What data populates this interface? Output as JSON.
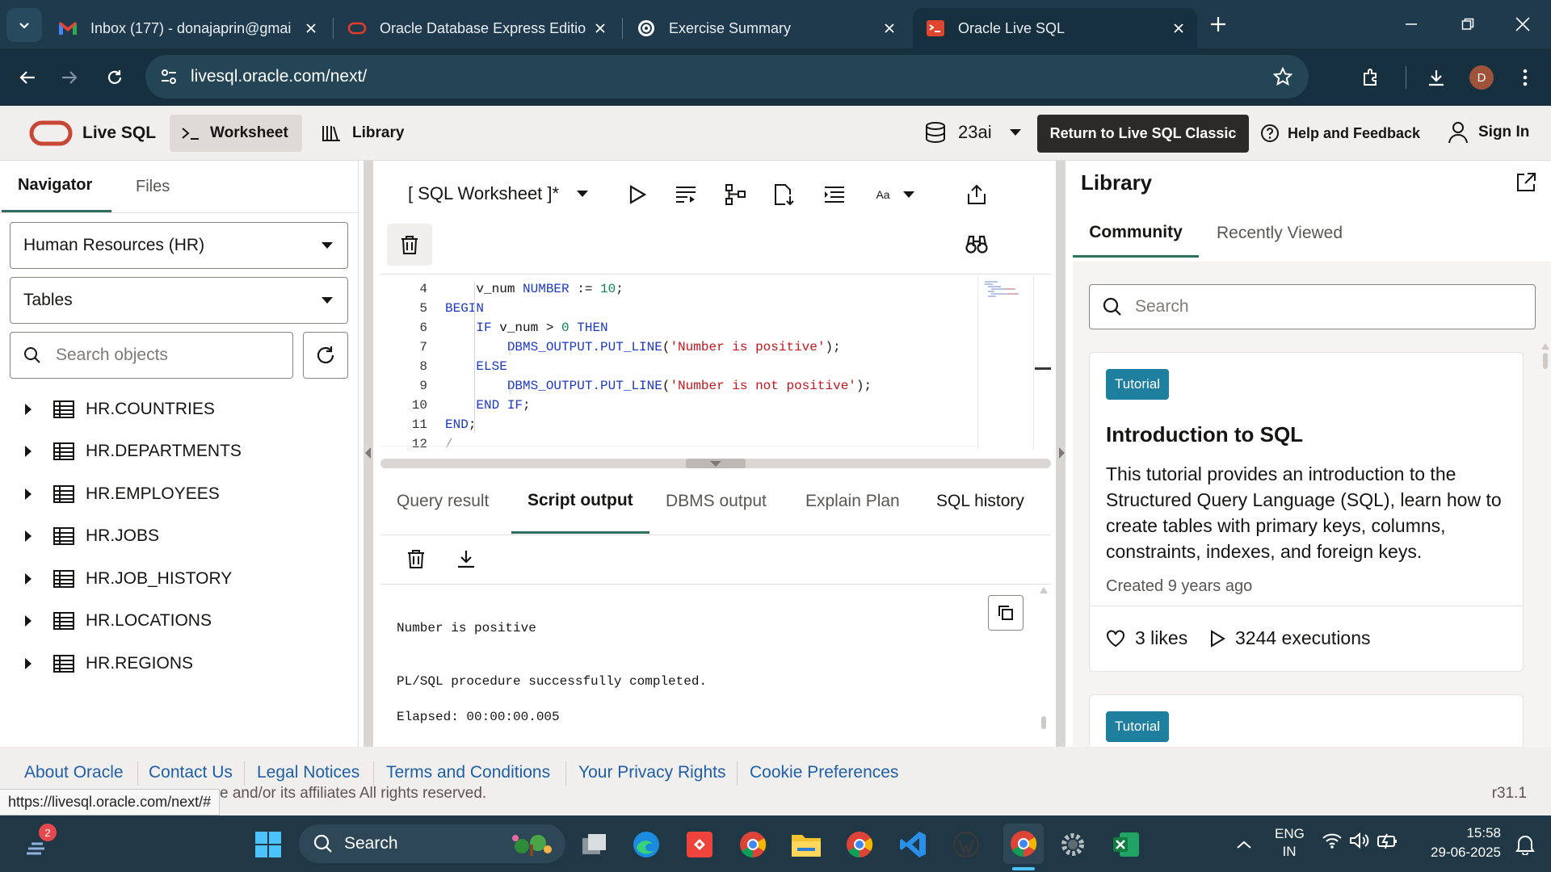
{
  "browser": {
    "tabs": [
      {
        "title": "Inbox (177) - donajaprin@gmai",
        "icon": "gmail-icon"
      },
      {
        "title": "Oracle Database Express Edition",
        "icon": "oracle-icon"
      },
      {
        "title": "Exercise Summary",
        "icon": "openai-icon"
      },
      {
        "title": "Oracle Live SQL",
        "icon": "livesql-icon"
      }
    ],
    "url": "livesql.oracle.com/next/",
    "profile_initial": "D"
  },
  "app": {
    "brand": "Live SQL",
    "nav": {
      "worksheet": "Worksheet",
      "library": "Library"
    },
    "db_version": "23ai",
    "classic_button": "Return to Live SQL Classic",
    "help": "Help and Feedback",
    "signin": "Sign In"
  },
  "navigator": {
    "tabs": [
      "Navigator",
      "Files"
    ],
    "schema": "Human Resources (HR)",
    "object_type": "Tables",
    "search_placeholder": "Search objects",
    "tables": [
      "HR.COUNTRIES",
      "HR.DEPARTMENTS",
      "HR.EMPLOYEES",
      "HR.JOBS",
      "HR.JOB_HISTORY",
      "HR.LOCATIONS",
      "HR.REGIONS"
    ]
  },
  "editor": {
    "title": "[ SQL Worksheet ]*",
    "font_label": "Aa",
    "lines": [
      {
        "n": "4"
      },
      {
        "n": "5"
      },
      {
        "n": "6"
      },
      {
        "n": "7"
      },
      {
        "n": "8"
      },
      {
        "n": "9"
      },
      {
        "n": "10"
      },
      {
        "n": "11"
      },
      {
        "n": "12"
      }
    ],
    "code": {
      "l4_var": "v_num ",
      "l4_type": "NUMBER",
      "l4_op": " := ",
      "l4_num": "10",
      "l4_end": ";",
      "l5": "BEGIN",
      "l6_if": "IF",
      "l6_mid": " v_num > ",
      "l6_num": "0",
      "l6_then": " THEN",
      "l7_fn": "DBMS_OUTPUT.PUT_LINE",
      "l7_open": "(",
      "l7_str": "'Number is positive'",
      "l7_close": ");",
      "l8": "ELSE",
      "l9_fn": "DBMS_OUTPUT.PUT_LINE",
      "l9_open": "(",
      "l9_str": "'Number is not positive'",
      "l9_close": ");",
      "l10_kw": "END IF",
      "l10_end": ";",
      "l11_kw": "END",
      "l11_end": ";",
      "l12": "/"
    }
  },
  "results": {
    "tabs": [
      "Query result",
      "Script output",
      "DBMS output",
      "Explain Plan",
      "SQL history"
    ],
    "output": [
      "Number is positive",
      "PL/SQL procedure successfully completed.",
      "Elapsed: 00:00:00.005"
    ]
  },
  "library": {
    "title": "Library",
    "tabs": [
      "Community",
      "Recently Viewed"
    ],
    "search_placeholder": "Search",
    "cards": [
      {
        "badge": "Tutorial",
        "title": "Introduction to SQL",
        "description": "This tutorial provides an introduction to the Structured Query Language (SQL), learn how to create tables with primary keys, columns, constraints, indexes, and foreign keys.",
        "created": "Created 9 years ago",
        "likes": "3 likes",
        "executions": "3244 executions"
      },
      {
        "badge": "Tutorial"
      }
    ]
  },
  "footer": {
    "links": [
      "About Oracle",
      "Contact Us",
      "Legal Notices",
      "Terms and Conditions",
      "Your Privacy Rights",
      "Cookie Preferences"
    ],
    "copyright": "e and/or its affiliates All rights reserved.",
    "version": "r31.1",
    "status_url": "https://livesql.oracle.com/next/#"
  },
  "taskbar": {
    "search": "Search",
    "notif_count": "2",
    "lang_top": "ENG",
    "lang_bottom": "IN",
    "time": "15:58",
    "date": "29-06-2025"
  },
  "colors": {
    "accent": "#2f6f5f",
    "oracle_red": "#c74634",
    "badge": "#1e7f9f",
    "link": "#1f5fa6"
  }
}
